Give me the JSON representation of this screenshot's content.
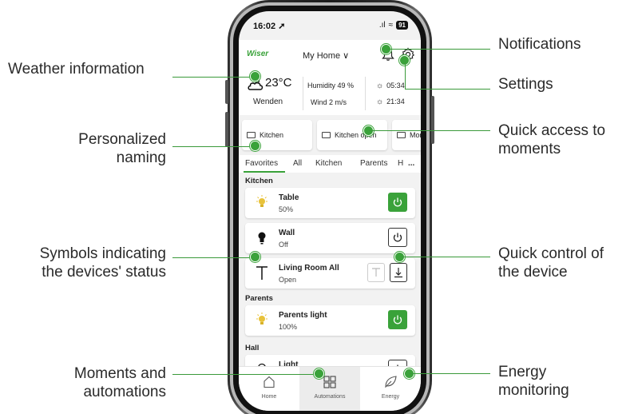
{
  "status_bar": {
    "time": "16:02",
    "signal": ".ıl",
    "wifi": "≈",
    "battery": "91"
  },
  "header": {
    "logo": "Wiser",
    "home_selector": "My Home ∨"
  },
  "weather": {
    "temperature": "23°C",
    "location": "Wenden",
    "humidity": "Humidity 49 %",
    "wind": "Wind 2 m/s",
    "sunrise": "05:34",
    "sunset": "21:34"
  },
  "moments": [
    {
      "label": "Kitchen"
    },
    {
      "label": "Kitchen open"
    },
    {
      "label": "Mor blin"
    }
  ],
  "tabs": [
    "Favorites",
    "All",
    "Kitchen",
    "Parents",
    "H",
    "..."
  ],
  "sections": {
    "kitchen": "Kitchen",
    "parents": "Parents",
    "hall": "Hall"
  },
  "devices": [
    {
      "name": "Table",
      "status": "50%",
      "icon": "bulb-on-icon",
      "state": "on"
    },
    {
      "name": "Wall",
      "status": "Off",
      "icon": "bulb-off-icon",
      "state": "off"
    },
    {
      "name": "Living Room All",
      "status": "Open",
      "icon": "blind-icon",
      "state": "blind"
    },
    {
      "name": "Parents light",
      "status": "100%",
      "icon": "bulb-on-icon",
      "state": "on"
    },
    {
      "name": "Light",
      "status": "",
      "icon": "bulb-off-icon",
      "state": "off"
    }
  ],
  "bottom_nav": [
    {
      "label": "Home",
      "icon": "home-icon"
    },
    {
      "label": "Automations",
      "icon": "grid-icon"
    },
    {
      "label": "Energy",
      "icon": "leaf-icon"
    }
  ],
  "callouts": {
    "weather": "Weather information",
    "naming_1": "Personalized",
    "naming_2": "naming",
    "symbols_1": "Symbols indicating",
    "symbols_2": "the devices' status",
    "moments_auto_1": "Moments and",
    "moments_auto_2": "automations",
    "notifications": "Notifications",
    "settings": "Settings",
    "quick_access_1": "Quick access to",
    "quick_access_2": "moments",
    "quick_control_1": "Quick control of",
    "quick_control_2": "the device",
    "energy_1": "Energy",
    "energy_2": "monitoring"
  },
  "colors": {
    "accent": "#3aa23a",
    "bulb_on": "#e8c23a"
  }
}
